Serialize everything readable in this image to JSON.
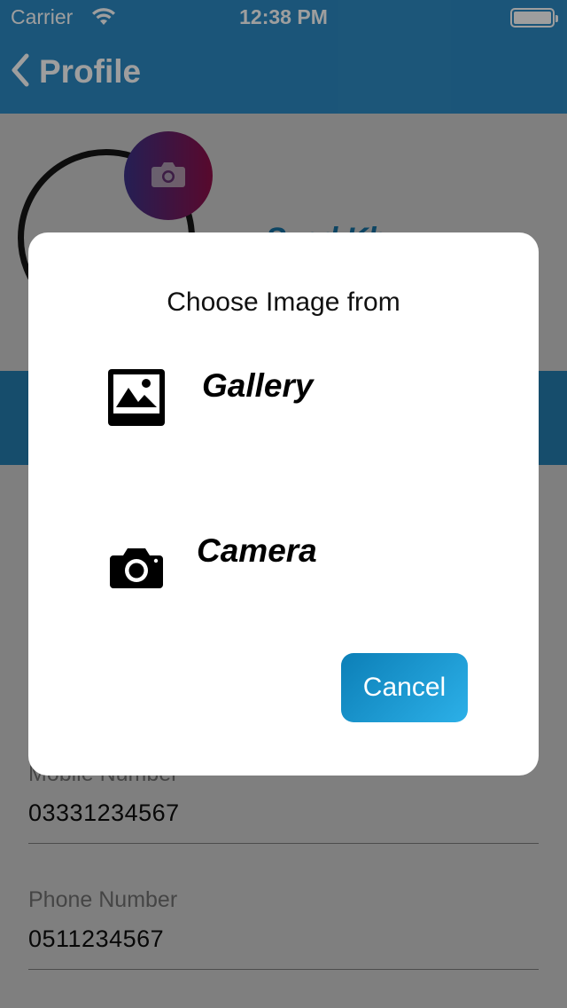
{
  "status_bar": {
    "carrier": "Carrier",
    "time": "12:38 PM",
    "wifi_icon": "wifi-icon",
    "battery_icon": "battery-icon"
  },
  "nav": {
    "back_label": "Profile",
    "back_icon": "chevron-left-icon"
  },
  "profile": {
    "name_partial": "Syed Kh",
    "avatar_camera_icon": "camera-icon"
  },
  "fields": [
    {
      "label": "Mobile Number",
      "value": "03331234567"
    },
    {
      "label": "Phone Number",
      "value": "0511234567"
    }
  ],
  "dialog": {
    "title": "Choose Image from",
    "options": [
      {
        "label": "Gallery",
        "icon": "gallery-icon"
      },
      {
        "label": "Camera",
        "icon": "camera-icon"
      }
    ],
    "cancel_label": "Cancel"
  },
  "colors": {
    "nav_bar": "#2d8ac3",
    "accent": "#1a8ac7",
    "band": "#2d9ad8",
    "cancel_start": "#0c7fb7",
    "cancel_end": "#2cb0e8",
    "avatar_gradient_start": "#4a3ea8",
    "avatar_gradient_end": "#b0125a"
  }
}
